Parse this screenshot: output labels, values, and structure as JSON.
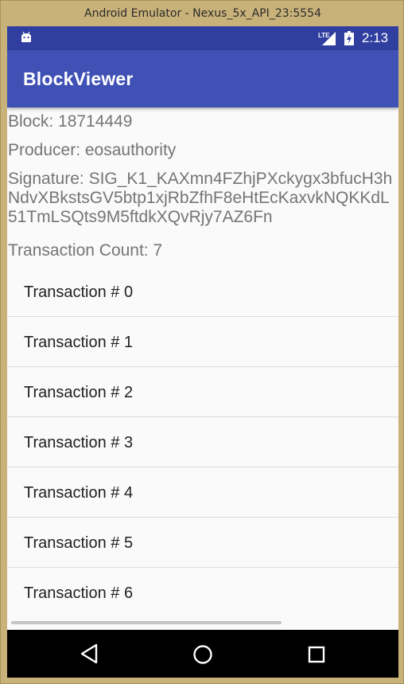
{
  "window": {
    "title": "Android Emulator - Nexus_5x_API_23:5554"
  },
  "status_bar": {
    "time": "2:13",
    "network": "LTE",
    "colors": {
      "status_bar": "#303f9f",
      "app_bar": "#3f51b5"
    }
  },
  "app_bar": {
    "title": "BlockViewer"
  },
  "block": {
    "block_line": "Block:  18714449",
    "producer_line": "Producer:  eosauthority",
    "signature_line": "Signature:  SIG_K1_KAXmn4FZhjPXckygx3bfucH3hNdvXBkstsGV5btp1xjRbZfhF8eHtEcKaxvkNQKKdL51TmLSQts9M5ftdkXQvRjy7AZ6Fn",
    "count_line": "Transaction Count: 7"
  },
  "transactions": [
    {
      "label": "Transaction # 0"
    },
    {
      "label": "Transaction # 1"
    },
    {
      "label": "Transaction # 2"
    },
    {
      "label": "Transaction # 3"
    },
    {
      "label": "Transaction # 4"
    },
    {
      "label": "Transaction # 5"
    },
    {
      "label": "Transaction # 6"
    }
  ],
  "nav_bar": {
    "icons": [
      "back-icon",
      "home-icon",
      "recents-icon"
    ]
  }
}
